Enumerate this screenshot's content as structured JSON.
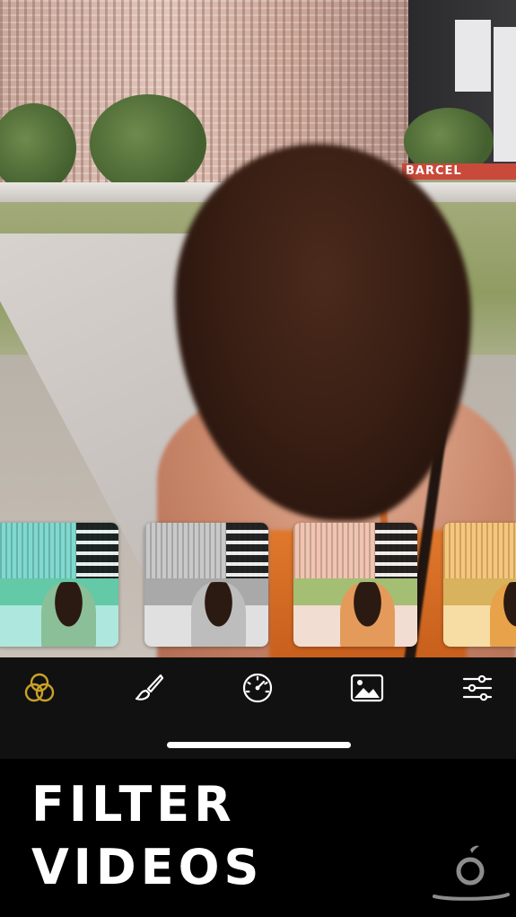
{
  "scene": {
    "background_sign_text": "BARCEL"
  },
  "filters": {
    "thumbnails": [
      {
        "name": "teal",
        "building": "#7fd9cf",
        "lawn": "#63c9a7",
        "ground": "#aee7dd",
        "skin": "#8bbf97"
      },
      {
        "name": "mono",
        "building": "#c9c9c9",
        "lawn": "#a9a9a9",
        "ground": "#e0e0e0",
        "skin": "#bdbdbd"
      },
      {
        "name": "warm",
        "building": "#f0c4b0",
        "lawn": "#a4bf73",
        "ground": "#f2ddd2",
        "skin": "#e39a5a"
      },
      {
        "name": "golden",
        "building": "#f6c77a",
        "lawn": "#d8b25c",
        "ground": "#f7dca4",
        "skin": "#e8a24a"
      }
    ]
  },
  "toolbar": {
    "accent": "#c9a227",
    "icon_color": "#ffffff",
    "tools": [
      {
        "id": "filters",
        "icon": "overlapping-circles-icon",
        "active": true
      },
      {
        "id": "brush",
        "icon": "brush-icon",
        "active": false
      },
      {
        "id": "speed",
        "icon": "speedometer-icon",
        "active": false
      },
      {
        "id": "image",
        "icon": "image-icon",
        "active": false
      },
      {
        "id": "adjust",
        "icon": "sliders-icon",
        "active": false
      }
    ]
  },
  "caption": {
    "line1": "FILTER",
    "line2": "VIDEOS"
  }
}
